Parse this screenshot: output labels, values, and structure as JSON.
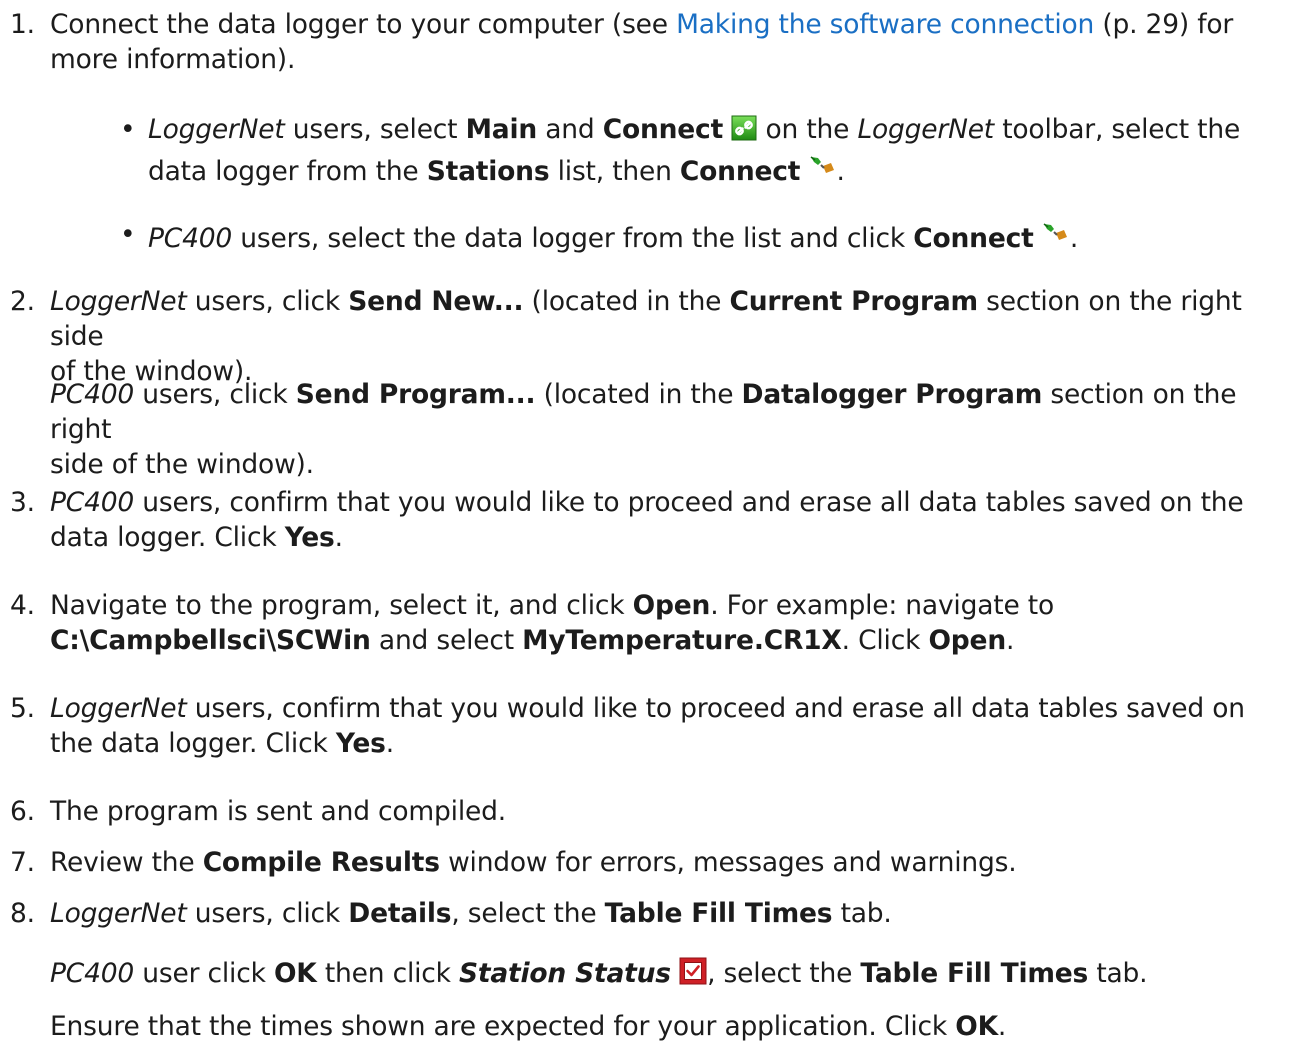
{
  "step1": {
    "num": "1.",
    "pre": "Connect the data logger to your computer (see ",
    "link": "Making the software connection",
    "post1": " (p. 29) for",
    "post2": "more information)."
  },
  "bullet1": {
    "a": "LoggerNet",
    "b": " users, select ",
    "c": "Main",
    "d": " and ",
    "e": "Connect",
    "f": " on the ",
    "g": "LoggerNet",
    "h": " toolbar, select the",
    "i": "data logger from the ",
    "j": "Stations",
    "k": " list, then ",
    "l": "Connect",
    "m": "."
  },
  "bullet2": {
    "a": "PC400",
    "b": " users, select the data logger from the list and click ",
    "c": "Connect",
    "d": "."
  },
  "step2": {
    "num": "2.",
    "a": "LoggerNet",
    "b": " users, click ",
    "c": "Send New...",
    "d": " (located in the ",
    "e": "Current Program",
    "f": " section on the right side",
    "g": "of the window)."
  },
  "step2b": {
    "a": "PC400",
    "b": " users, click ",
    "c": "Send Program...",
    "d": " (located in the ",
    "e": "Datalogger Program",
    "f": " section on the right",
    "g": "side of the window)."
  },
  "step3": {
    "num": "3.",
    "a": "PC400",
    "b": " users, confirm that you would like to proceed and erase all data tables saved on the",
    "c": "data logger. Click ",
    "d": "Yes",
    "e": "."
  },
  "step4": {
    "num": "4.",
    "a": "Navigate to the program, select it, and click ",
    "b": "Open",
    "c": ". For example: navigate to",
    "d": "C:\\Campbellsci\\SCWin",
    "e": " and select ",
    "f": "MyTemperature.CR1X",
    "g": ". Click ",
    "h": "Open",
    "i": "."
  },
  "step5": {
    "num": "5.",
    "a": "LoggerNet",
    "b": " users, confirm that you would like to proceed and erase all data tables saved on",
    "c": "the data logger. Click ",
    "d": "Yes",
    "e": "."
  },
  "step6": {
    "num": "6.",
    "a": "The program is sent and compiled."
  },
  "step7": {
    "num": "7.",
    "a": "Review the ",
    "b": "Compile Results",
    "c": " window for errors, messages and warnings."
  },
  "step8": {
    "num": "8.",
    "a": "LoggerNet",
    "b": " users, click ",
    "c": "Details",
    "d": ", select the ",
    "e": "Table Fill Times",
    "f": " tab."
  },
  "step8b": {
    "a": "PC400",
    "b": " user click ",
    "c": "OK",
    "d": " then click ",
    "e": "Station Status",
    "f": ", select the ",
    "g": "Table Fill Times",
    "h": " tab."
  },
  "step8c": {
    "a": "Ensure that the times shown are expected for your application. Click ",
    "b": "OK",
    "c": "."
  },
  "icons": {
    "connect_toolbar": "link-icon",
    "connect_plug": "plug-icon",
    "station_status": "checkbox-icon"
  },
  "colors": {
    "link": "#1a6fc4",
    "text": "#1c1c1c"
  }
}
